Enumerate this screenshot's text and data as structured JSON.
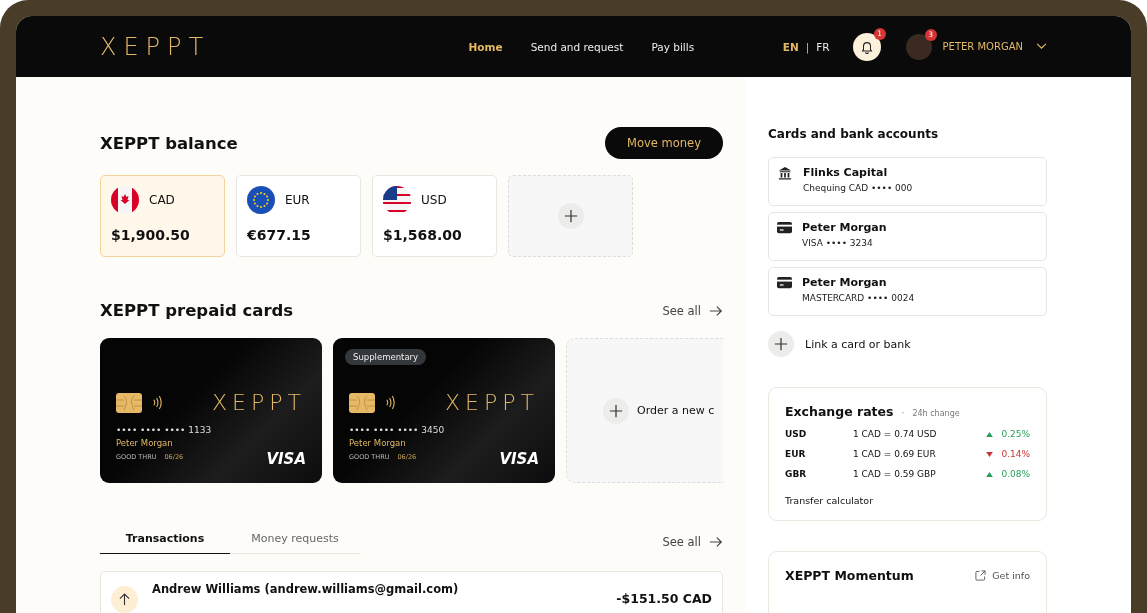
{
  "nav": {
    "logo": "XEPPT",
    "links": [
      {
        "label": "Home",
        "selected": true
      },
      {
        "label": "Send and request",
        "selected": false
      },
      {
        "label": "Pay bills",
        "selected": false
      }
    ],
    "languages": [
      {
        "label": "EN",
        "selected": true
      },
      {
        "label": "FR",
        "selected": false
      }
    ],
    "language_separator": "|",
    "notification_count": "1",
    "user_badge": "3",
    "user_name": "PETER MORGAN"
  },
  "balance": {
    "title": "XEPPT balance",
    "button": "Move money",
    "currencies": [
      {
        "code": "CAD",
        "kind": "ca",
        "amount": "$1,900.50",
        "selected": true
      },
      {
        "code": "EUR",
        "kind": "eu",
        "amount": "€677.15",
        "selected": false
      },
      {
        "code": "USD",
        "kind": "us",
        "amount": "$1,568.00",
        "selected": false
      }
    ]
  },
  "prepaid": {
    "title": "XEPPT prepaid cards",
    "see_all": "See all",
    "cards": [
      {
        "logo": "XEPPT",
        "number": "•••• •••• •••• 1133",
        "holder": "Peter Morgan",
        "good_thru": "GOOD THRU",
        "expiry": "06/26",
        "network": "VISA"
      },
      {
        "badge": "Supplementary",
        "logo": "XEPPT",
        "number": "•••• •••• •••• 3450",
        "holder": "Peter Morgan",
        "good_thru": "GOOD THRU",
        "expiry": "06/26",
        "network": "VISA"
      }
    ],
    "order": "Order a new c"
  },
  "activity": {
    "tabs": [
      {
        "label": "Transactions",
        "selected": true
      },
      {
        "label": "Money requests",
        "selected": false
      }
    ],
    "see_all": "See all",
    "transactions": [
      {
        "kind": "out",
        "name": "Andrew Williams (andrew.williams@gmail.com)",
        "amount": "-$151.50 CAD"
      }
    ]
  },
  "accounts": {
    "title": "Cards and bank accounts",
    "items": [
      {
        "kind": "bank",
        "name": "Flinks Capital",
        "detail": "Chequing CAD •••• 000"
      },
      {
        "kind": "card",
        "name": "Peter Morgan",
        "detail": "VISA •••• 3234"
      },
      {
        "kind": "card",
        "name": "Peter Morgan",
        "detail": "MASTERCARD •••• 0024"
      }
    ],
    "link": "Link a card or bank"
  },
  "rates": {
    "title": "Exchange rates",
    "separator": "·",
    "subtitle": "24h change",
    "rows": [
      {
        "code": "USD",
        "rate": "1 CAD = 0.74 USD",
        "change": "0.25%",
        "kind": "up"
      },
      {
        "code": "EUR",
        "rate": "1 CAD = 0.69 EUR",
        "change": "0.14%",
        "kind": "down"
      },
      {
        "code": "GBR",
        "rate": "1 CAD = 0.59 GBP",
        "change": "0.08%",
        "kind": "up"
      }
    ],
    "calculator": "Transfer calculator"
  },
  "momentum": {
    "title": "XEPPT Momentum",
    "link": "Get info"
  }
}
